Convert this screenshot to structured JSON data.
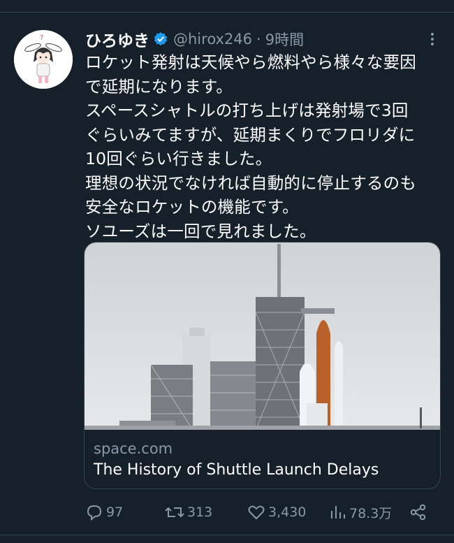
{
  "tweet": {
    "display_name": "ひろゆき",
    "handle": "@hirox246",
    "separator": "·",
    "time": "9時間",
    "text_lines": [
      "ロケット発射は天候やら燃料やら様々な要因",
      "で延期になります。",
      "スペースシャトルの打ち上げは発射場で3回",
      "ぐらいみてますが、延期まくりでフロリダに",
      "10回ぐらい行きました。",
      "理想の状況でなければ自動的に停止するのも",
      "安全なロケットの機能です。",
      "ソユーズは一回で見れました。"
    ]
  },
  "card": {
    "domain": "space.com",
    "title": "The History of Shuttle Launch Delays"
  },
  "actions": {
    "replies": "97",
    "retweets": "313",
    "likes": "3,430",
    "views": "78.3万"
  },
  "icons": {
    "verified": "verified-badge-icon",
    "more": "more-options-icon",
    "reply": "reply-icon",
    "retweet": "retweet-icon",
    "like": "heart-icon",
    "views": "views-chart-icon",
    "share": "share-icon"
  },
  "colors": {
    "background": "#15202b",
    "secondary_text": "#8b98a5",
    "verified_blue": "#1d9bf0",
    "border": "#38444d"
  }
}
